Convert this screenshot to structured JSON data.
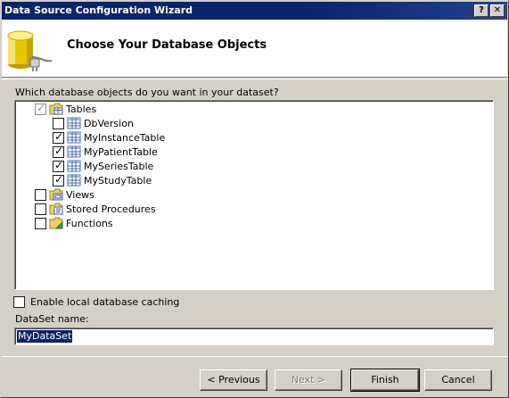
{
  "window": {
    "title": "Data Source Configuration Wizard"
  },
  "titlebar_buttons": {
    "help": "?",
    "close": "✕"
  },
  "header": {
    "heading": "Choose Your Database Objects",
    "icon": "database-plug-icon"
  },
  "prompt": "Which database objects do you want in your dataset?",
  "tree": {
    "tables": {
      "label": "Tables",
      "state": "indeterminate"
    },
    "table_items": [
      {
        "label": "DbVersion",
        "checked": false
      },
      {
        "label": "MyInstanceTable",
        "checked": true
      },
      {
        "label": "MyPatientTable",
        "checked": true
      },
      {
        "label": "MySeriesTable",
        "checked": true
      },
      {
        "label": "MyStudyTable",
        "checked": true
      }
    ],
    "views": {
      "label": "Views",
      "checked": false
    },
    "stored_procedures": {
      "label": "Stored Procedures",
      "checked": false
    },
    "functions": {
      "label": "Functions",
      "checked": false
    }
  },
  "cache": {
    "label": "Enable local database caching",
    "checked": false
  },
  "dataset": {
    "label": "DataSet name:",
    "value": "MyDataSet"
  },
  "buttons": {
    "previous": "< Previous",
    "next": "Next >",
    "finish": "Finish",
    "cancel": "Cancel"
  }
}
